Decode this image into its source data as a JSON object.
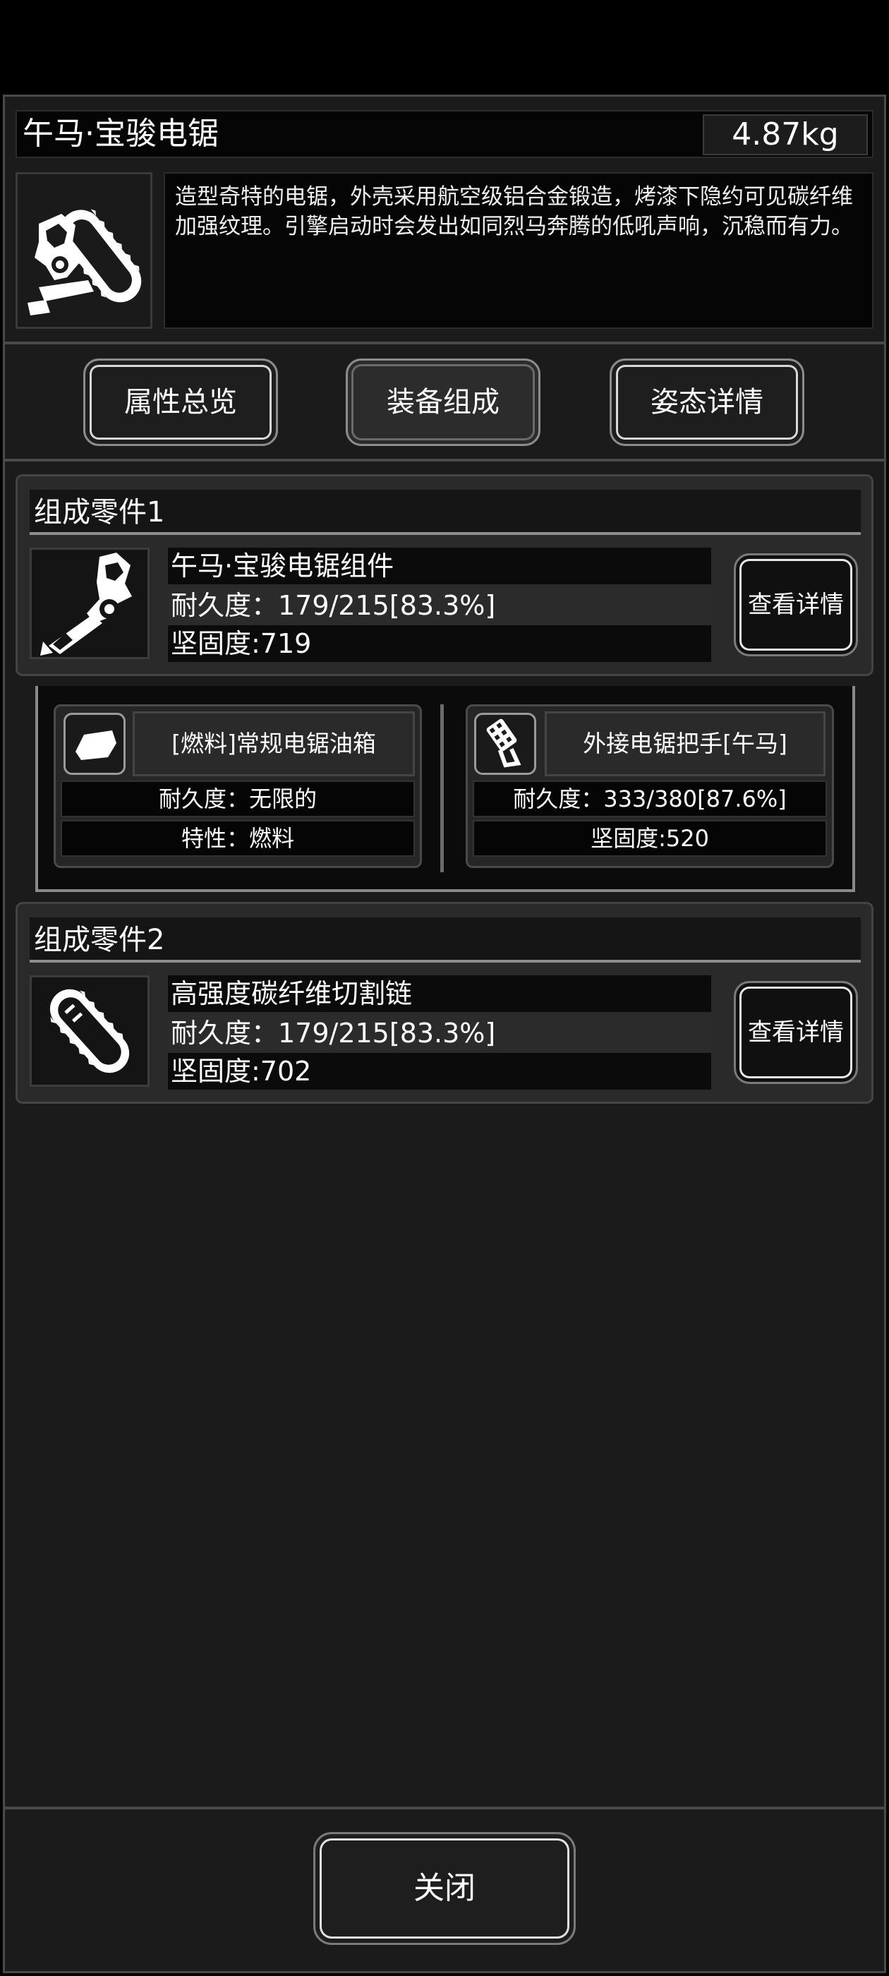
{
  "item": {
    "name": "午马·宝骏电锯",
    "weight": "4.87kg",
    "description": "造型奇特的电锯，外壳采用航空级铝合金锻造，烤漆下隐约可见碳纤维加强纹理。引擎启动时会发出如同烈马奔腾的低吼声响，沉稳而有力。",
    "icon": "chainsaw-horse-icon"
  },
  "tabs": [
    {
      "label": "属性总览"
    },
    {
      "label": "装备组成"
    },
    {
      "label": "姿态详情"
    }
  ],
  "active_tab": "装备组成",
  "parts": [
    {
      "header": "组成零件1",
      "name": "午马·宝骏电锯组件",
      "durability": "耐久度：179/215[83.3%]",
      "hardness": "坚固度:719",
      "icon": "chainsaw-body-icon",
      "detail_label": "查看详情"
    },
    {
      "header": "组成零件2",
      "name": "高强度碳纤维切割链",
      "durability": "耐久度：179/215[83.3%]",
      "hardness": "坚固度:702",
      "icon": "chain-blade-icon",
      "detail_label": "查看详情"
    }
  ],
  "subparts": [
    {
      "name": "[燃料]常规电锯油箱",
      "line1": "耐久度：无限的",
      "line2": "特性：燃料",
      "icon": "fuel-tank-icon"
    },
    {
      "name": "外接电锯把手[午马]",
      "line1": "耐久度：333/380[87.6%]",
      "line2": "坚固度:520",
      "icon": "handle-icon"
    }
  ],
  "close_label": "关闭"
}
